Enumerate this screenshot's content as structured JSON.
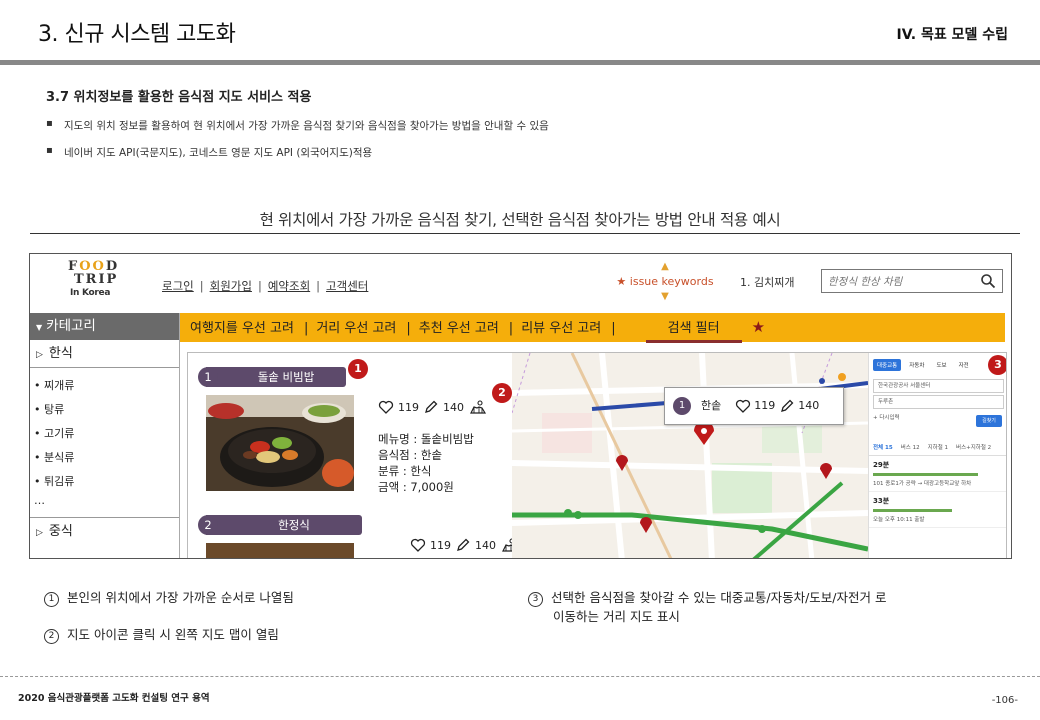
{
  "slide": {
    "title": "3. 신규 시스템 고도화",
    "section": "IV.  목표 모델 수립",
    "sub_heading": "3.7 위치정보를 활용한 음식점 지도 서비스 적용",
    "bullets": [
      "지도의 위치 정보를 활용하여 현 위치에서 가장 가까운 음식점 찾기와 음식점을 찾아가는 방법을 안내할 수 있음",
      "네이버 지도 API(국문지도), 코네스트 영문 지도 API (외국어지도)적용"
    ],
    "example_caption": "현 위치에서 가장 가까운 음식점 찾기, 선택한 음식점 찾아가는 방법 안내 적용 예시"
  },
  "site": {
    "logo": {
      "line1_a": "F",
      "line1_o": "OO",
      "line1_b": "D",
      "line2": "TRIP",
      "line3": "In Korea"
    },
    "nav": [
      "로그인",
      "회원가입",
      "예약조회",
      "고객센터"
    ],
    "issue_label": "★ issue keywords",
    "issue_up": "▲",
    "issue_down": "▼",
    "keyword": "1. 김치찌개",
    "search": {
      "placeholder": "한정식 한상 차림"
    },
    "sidebar": {
      "header": "카테고리",
      "header_icon": "▼",
      "group1": "한식",
      "group1_icon": "▷",
      "subitems": [
        "• 찌개류",
        "• 탕류",
        "• 고기류",
        "• 분식류",
        "• 튀김류",
        "…"
      ],
      "group2": "중식",
      "group2_icon": "▷"
    },
    "filters": [
      "여행지를 우선 고려",
      "거리 우선 고려",
      "추천 우선 고려",
      "리뷰 우선 고려"
    ],
    "filter_sep": "|",
    "search_filter": "검색 필터",
    "filter_star": "★",
    "results": [
      {
        "num": "1",
        "name": "돌솥 비빔밥",
        "likes": "119",
        "reviews": "140",
        "menu": "메뉴명 : 돌솥비빔밥",
        "restaurant": "음식점 : 한솥",
        "category": "분류 : 한식",
        "price": "금액 : 7,000원"
      },
      {
        "num": "2",
        "name": "한정식",
        "likes": "119",
        "reviews": "140"
      }
    ],
    "map_callout": {
      "num": "1",
      "name": "한솥",
      "likes": "119",
      "reviews": "140"
    },
    "badges": [
      "1",
      "2",
      "3"
    ],
    "transit": {
      "tabs": [
        "대중교통",
        "자동차",
        "도보",
        "자전"
      ],
      "from": "한국관광공사 서울센터",
      "to": "두루촌",
      "add": "+ 다시입력",
      "go": "길찾기",
      "sub": [
        "전체 15",
        "버스 12",
        "지하철 1",
        "버스+지하철 2"
      ],
      "routes": [
        {
          "time": "29분",
          "line": "101 종로1가 공략 → 대광고등학교앞 하차"
        },
        {
          "time": "33분",
          "line": "오늘 오후 10:11 출발"
        }
      ]
    }
  },
  "notes": {
    "n1": {
      "mark": "1",
      "text": "본인의 위치에서 가장 가까운 순서로 나열됨"
    },
    "n2": {
      "mark": "2",
      "text": "지도 아이콘 클릭 시 왼쪽 지도 맵이 열림"
    },
    "n3": {
      "mark": "3",
      "text": "선택한 음식점을 찾아갈 수 있는 대중교통/자동차/도보/자전거 로",
      "text2": "이동하는 거리 지도 표시"
    }
  },
  "footer": {
    "left": "2020 음식관광플랫폼 고도화 컨설팅 연구 용역",
    "right": "-106-"
  },
  "colors": {
    "filter_bar": "#f5ae0b",
    "label_purple": "#5d4a6b",
    "badge_red": "#c01a1a",
    "sidebar_head": "#6a6a6a"
  }
}
